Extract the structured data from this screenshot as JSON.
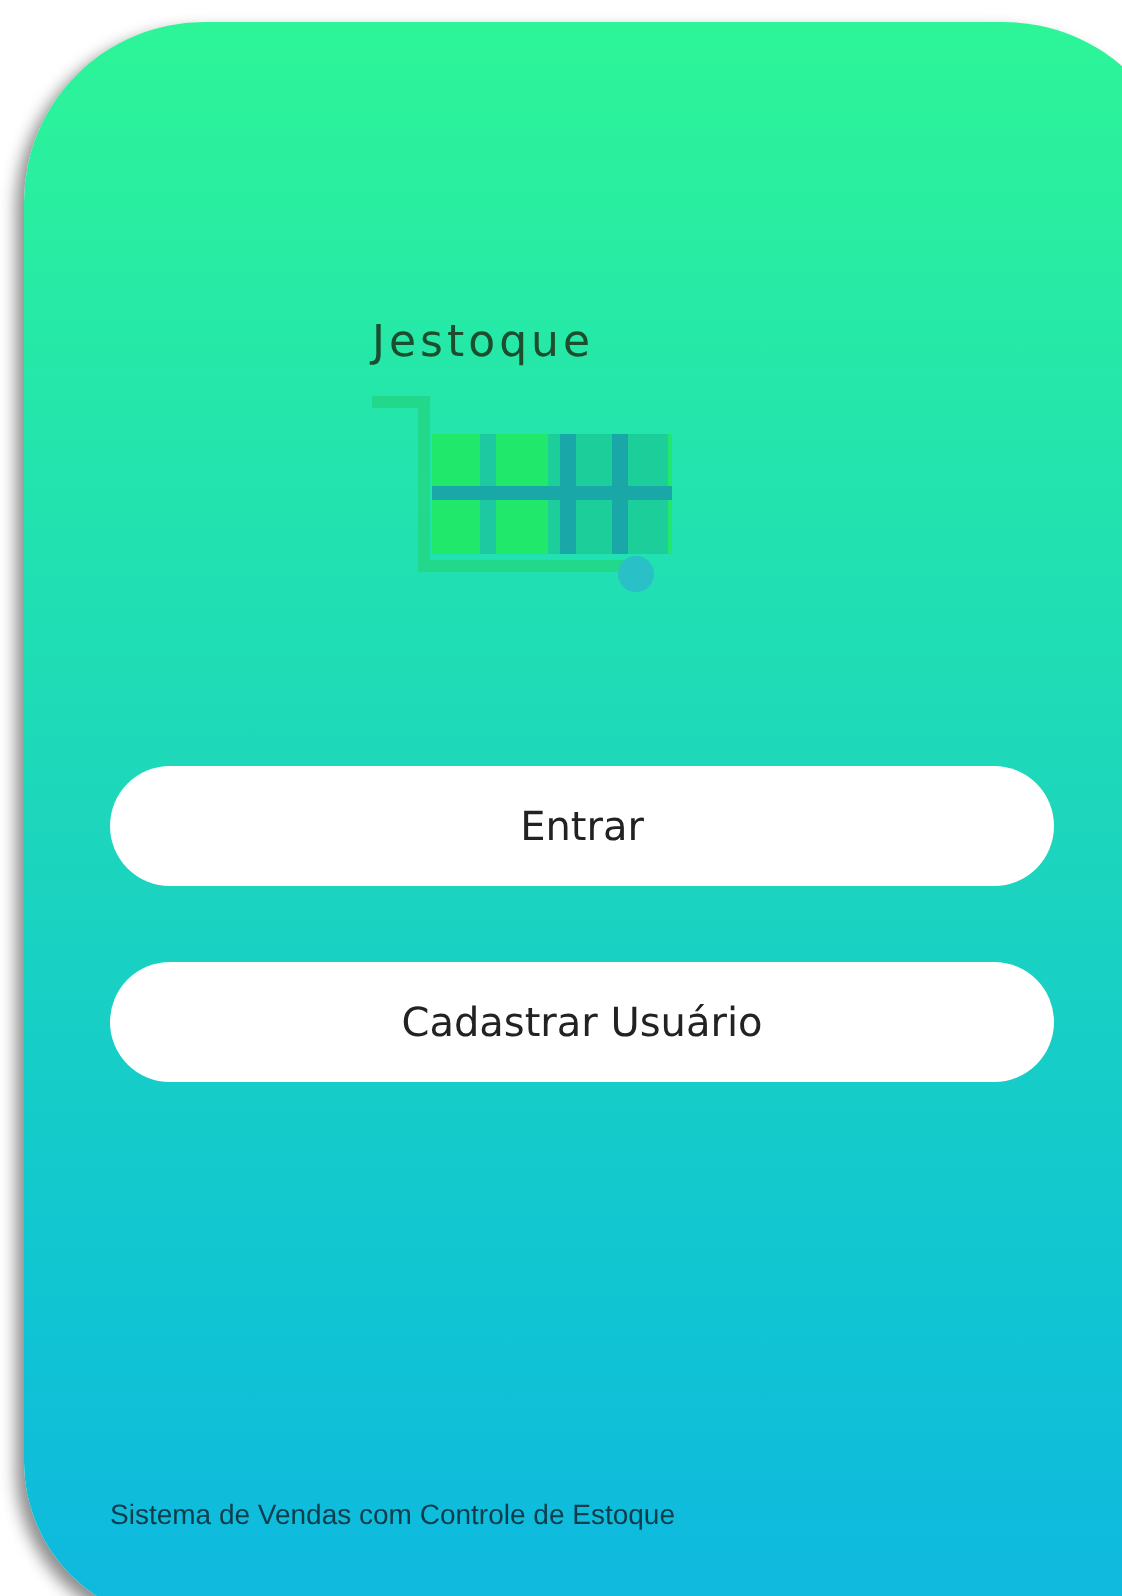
{
  "app": {
    "logo_text": "Jestoque"
  },
  "buttons": [
    {
      "label": "Entrar"
    },
    {
      "label": "Cadastrar Usuário"
    }
  ],
  "footer": "Sistema de Vendas com Controle de Estoque"
}
